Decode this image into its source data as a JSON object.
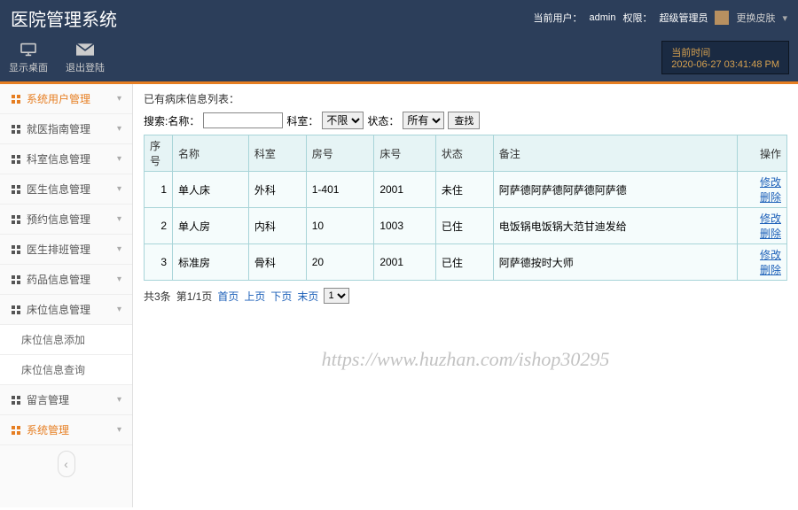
{
  "header": {
    "title": "医院管理系统",
    "user_label": "当前用户：",
    "user": "admin",
    "role_label": "权限：",
    "role": "超级管理员",
    "skin": "更换皮肤"
  },
  "toolbar": {
    "desktop": "显示桌面",
    "logout": "退出登陆",
    "time_label": "当前时间",
    "time_value": "2020-06-27 03:41:48 PM"
  },
  "sidebar": {
    "items": [
      {
        "label": "系统用户管理",
        "active": true
      },
      {
        "label": "就医指南管理"
      },
      {
        "label": "科室信息管理"
      },
      {
        "label": "医生信息管理"
      },
      {
        "label": "预约信息管理"
      },
      {
        "label": "医生排班管理"
      },
      {
        "label": "药品信息管理"
      },
      {
        "label": "床位信息管理",
        "expanded": true
      },
      {
        "label": "留言管理"
      },
      {
        "label": "系统管理",
        "active": true
      }
    ],
    "sub_bed": [
      {
        "label": "床位信息添加"
      },
      {
        "label": "床位信息查询"
      }
    ]
  },
  "content": {
    "list_title": "已有病床信息列表：",
    "search_label": "搜索:名称：",
    "dept_label": "科室：",
    "dept_value": "不限",
    "status_label": "状态：",
    "status_value": "所有",
    "search_btn": "查找",
    "columns": [
      "序号",
      "名称",
      "科室",
      "房号",
      "床号",
      "状态",
      "备注",
      "操作"
    ],
    "rows": [
      {
        "idx": "1",
        "name": "单人床",
        "dept": "外科",
        "room": "1-401",
        "bed": "2001",
        "status": "未住",
        "remark": "阿萨德阿萨德阿萨德阿萨德"
      },
      {
        "idx": "2",
        "name": "单人房",
        "dept": "内科",
        "room": "10",
        "bed": "1003",
        "status": "已住",
        "remark": "电饭锅电饭锅大范甘迪发给"
      },
      {
        "idx": "3",
        "name": "标准房",
        "dept": "骨科",
        "room": "20",
        "bed": "2001",
        "status": "已住",
        "remark": "阿萨德按时大师"
      }
    ],
    "op_edit": "修改",
    "op_del": "删除",
    "pager": {
      "total": "共3条",
      "page": "第1/1页",
      "first": "首页",
      "prev": "上页",
      "next": "下页",
      "last": "末页",
      "sel": "1"
    }
  },
  "watermark": "https://www.huzhan.com/ishop30295"
}
